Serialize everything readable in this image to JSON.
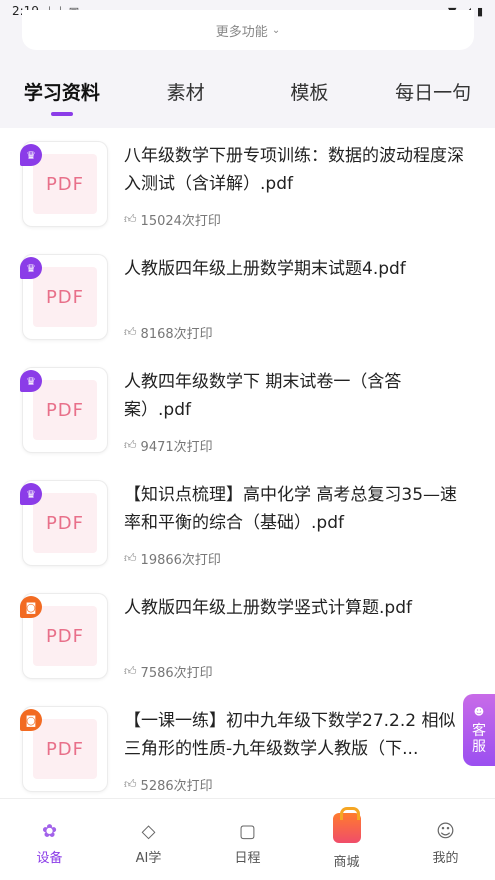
{
  "status_bar": {
    "time": "2:19",
    "icons_left": [
      "download-icon",
      "download-icon",
      "app-icon"
    ],
    "icons_right": [
      "wifi-icon",
      "signal-icon",
      "battery-icon"
    ]
  },
  "more_card": {
    "label": "更多功能",
    "icon": "chevron-down-icon"
  },
  "tabs": [
    {
      "label": "学习资料",
      "active": true
    },
    {
      "label": "素材",
      "active": false
    },
    {
      "label": "模板",
      "active": false
    },
    {
      "label": "每日一句",
      "active": false
    }
  ],
  "items": [
    {
      "title": "八年级数学下册专项训练：数据的波动程度深入测试（含详解）.pdf",
      "prints": "15024次打印",
      "thumb": "PDF",
      "badge_color": "#8b3ce8"
    },
    {
      "title": "人教版四年级上册数学期末试题4.pdf",
      "prints": "8168次打印",
      "thumb": "PDF",
      "badge_color": "#8b3ce8"
    },
    {
      "title": "人教四年级数学下 期末试卷一（含答案）.pdf",
      "prints": "9471次打印",
      "thumb": "PDF",
      "badge_color": "#8b3ce8"
    },
    {
      "title": "【知识点梳理】高中化学 高考总复习35—速率和平衡的综合（基础）.pdf",
      "prints": "19866次打印",
      "thumb": "PDF",
      "badge_color": "#8b3ce8"
    },
    {
      "title": "人教版四年级上册数学竖式计算题.pdf",
      "prints": "7586次打印",
      "thumb": "PDF",
      "badge_color": "#f26b22"
    },
    {
      "title": "【一课一练】初中九年级下数学27.2.2 相似三角形的性质-九年级数学人教版（下...",
      "prints": "5286次打印",
      "thumb": "PDF",
      "badge_color": "#f26b22"
    }
  ],
  "service": {
    "label_1": "客",
    "label_2": "服"
  },
  "bottom_nav": [
    {
      "label": "设备",
      "icon": "grid-icon",
      "active": true
    },
    {
      "label": "AI学",
      "icon": "graduation-cap-icon",
      "active": false
    },
    {
      "label": "日程",
      "icon": "calendar-icon",
      "active": false
    },
    {
      "label": "商城",
      "icon": "shopping-bag-icon",
      "active": false
    },
    {
      "label": "我的",
      "icon": "smile-face-icon",
      "active": false
    }
  ],
  "colors": {
    "accent": "#8b3ce8",
    "pdf_text": "#e8708a",
    "orange_badge": "#f26b22"
  }
}
